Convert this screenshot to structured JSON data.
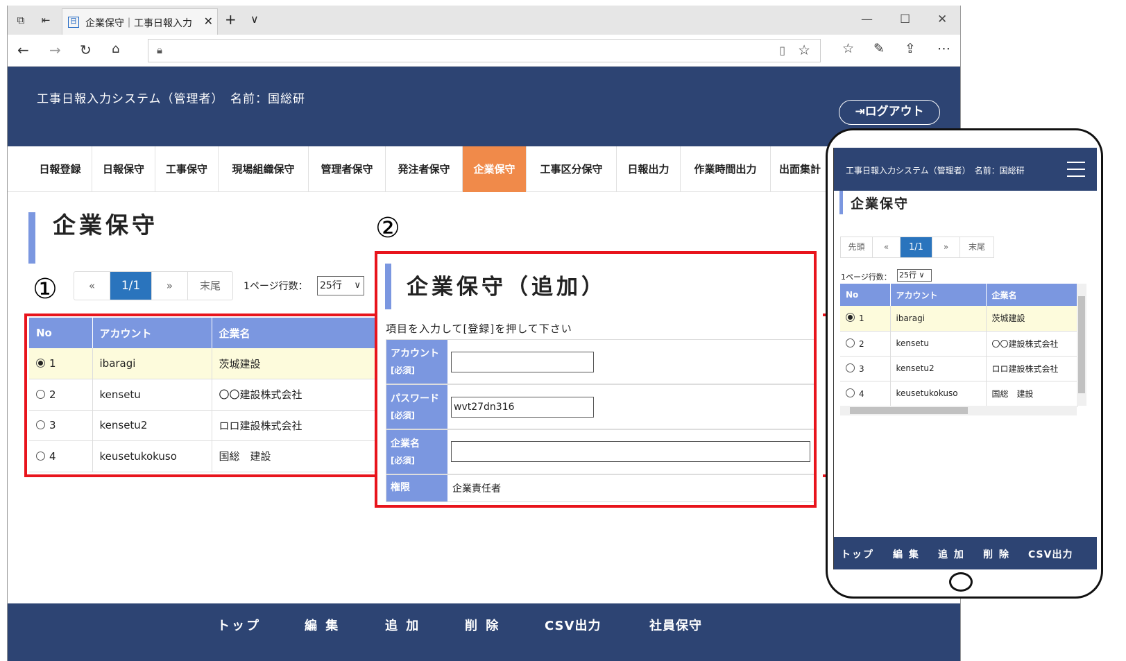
{
  "browser": {
    "tab_title": "企業保守｜工事日報入力",
    "icons": [
      "tab-actions-icon",
      "set-aside-icon",
      "favicon",
      "close-icon",
      "new-tab-icon",
      "tab-list-icon",
      "minimize-icon",
      "maximize-icon",
      "close-window-icon",
      "back-icon",
      "forward-icon",
      "refresh-icon",
      "home-icon",
      "lock-icon",
      "reading-view-icon",
      "favorite-star-icon",
      "favorites-list-icon",
      "pen-icon",
      "share-icon",
      "more-icon"
    ]
  },
  "app": {
    "title": "工事日報入力システム（管理者）　名前：国総研",
    "logout_label": "ログアウト",
    "nav": [
      "日報登録",
      "日報保守",
      "工事保守",
      "現場組織保守",
      "管理者保守",
      "発注者保守",
      "企業保守",
      "工事区分保守",
      "日報出力",
      "作業時間出力",
      "出面集計"
    ],
    "active_nav": "企業保守",
    "page_title": "企業保守",
    "markers": {
      "one": "①",
      "two": "②"
    }
  },
  "pager": {
    "prev": "«",
    "page": "1/1",
    "next": "»",
    "last": "末尾",
    "first": "先頭",
    "rows_label": "1ページ行数：",
    "rows_value": "25行"
  },
  "table": {
    "headers": [
      "No",
      "アカウント",
      "企業名"
    ],
    "rows": [
      {
        "no": "1",
        "account": "ibaragi",
        "company": "茨城建設",
        "selected": true
      },
      {
        "no": "2",
        "account": "kensetu",
        "company": "〇〇建設株式会社",
        "selected": false
      },
      {
        "no": "3",
        "account": "kensetu2",
        "company": "ロロ建設株式会社",
        "selected": false
      },
      {
        "no": "4",
        "account": "keusetukokuso",
        "company": "国総　建設",
        "selected": false
      }
    ]
  },
  "form": {
    "title": "企業保守（追加）",
    "instruction": "項目を入力して[登録]を押して下さい",
    "required": "[必須]",
    "account_label": "アカウント",
    "account_value": "",
    "password_label": "パスワード",
    "password_value": "wvt27dn316",
    "company_label": "企業名",
    "company_value": "",
    "role_label": "権限",
    "role_value": "企業責任者"
  },
  "footer": [
    "トップ",
    "編 集",
    "追 加",
    "削 除",
    "CSV出力",
    "社員保守"
  ],
  "mobile": {
    "title": "工事日報入力システム（管理者）　名前：国総研",
    "page_title": "企業保守",
    "rows_label": "1ページ行数：",
    "rows_value": "25行",
    "footer": [
      "トップ",
      "編 集",
      "追 加",
      "削 除",
      "CSV出力"
    ]
  },
  "colors": {
    "header": "#2d4473",
    "accent": "#7b97e0",
    "active_tab": "#f08a4a",
    "highlight": "#e8141c",
    "page_active": "#2a74bd"
  }
}
